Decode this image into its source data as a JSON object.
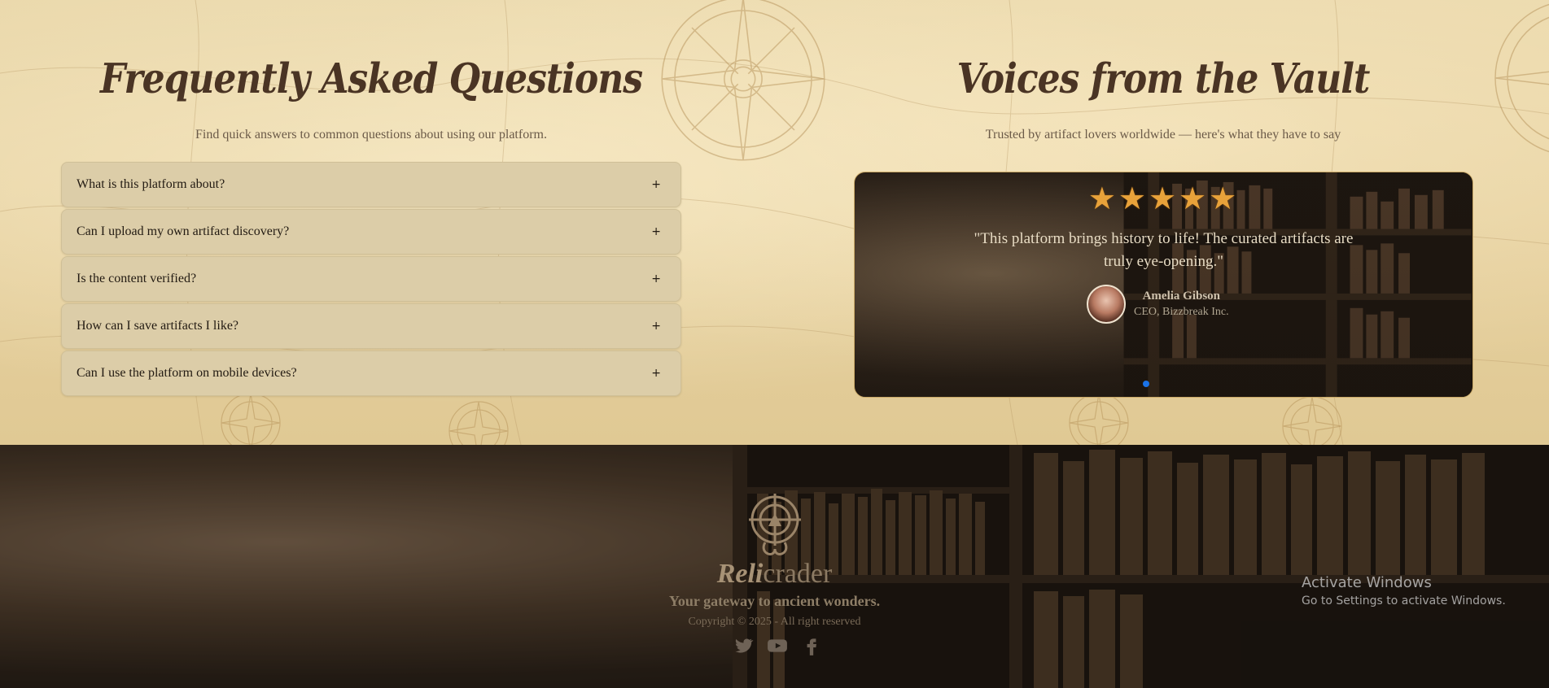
{
  "faq": {
    "title": "Frequently Asked Questions",
    "subtitle": "Find quick answers to common questions about using our platform.",
    "items": [
      {
        "question": "What is this platform about?",
        "toggle": "+"
      },
      {
        "question": "Can I upload my own artifact discovery?",
        "toggle": "+"
      },
      {
        "question": "Is the content verified?",
        "toggle": "+"
      },
      {
        "question": "How can I save artifacts I like?",
        "toggle": "+"
      },
      {
        "question": "Can I use the platform on mobile devices?",
        "toggle": "+"
      }
    ]
  },
  "testimonials": {
    "title": "Voices from the Vault",
    "subtitle": "Trusted by artifact lovers worldwide — here's what they have to say",
    "active": {
      "stars": "★★★★★",
      "rating": 5,
      "quote": "\"This platform brings history to life! The curated artifacts are truly eye-opening.\"",
      "author_name": "Amelia Gibson",
      "author_role": "CEO, Bizzbreak Inc."
    },
    "dot_color": "#1a73e8"
  },
  "footer": {
    "brand_part1": "Reli",
    "brand_part2": "crader",
    "tagline": "Your gateway to ancient wonders.",
    "copyright": "Copyright © 2025 - All right reserved",
    "socials": [
      "twitter-icon",
      "youtube-icon",
      "facebook-icon"
    ]
  },
  "os_overlay": {
    "title": "Activate Windows",
    "subtitle": "Go to Settings to activate Windows."
  },
  "colors": {
    "parchment": "#e7d3a4",
    "heading": "#4a3424",
    "star": "#e8a23a"
  }
}
